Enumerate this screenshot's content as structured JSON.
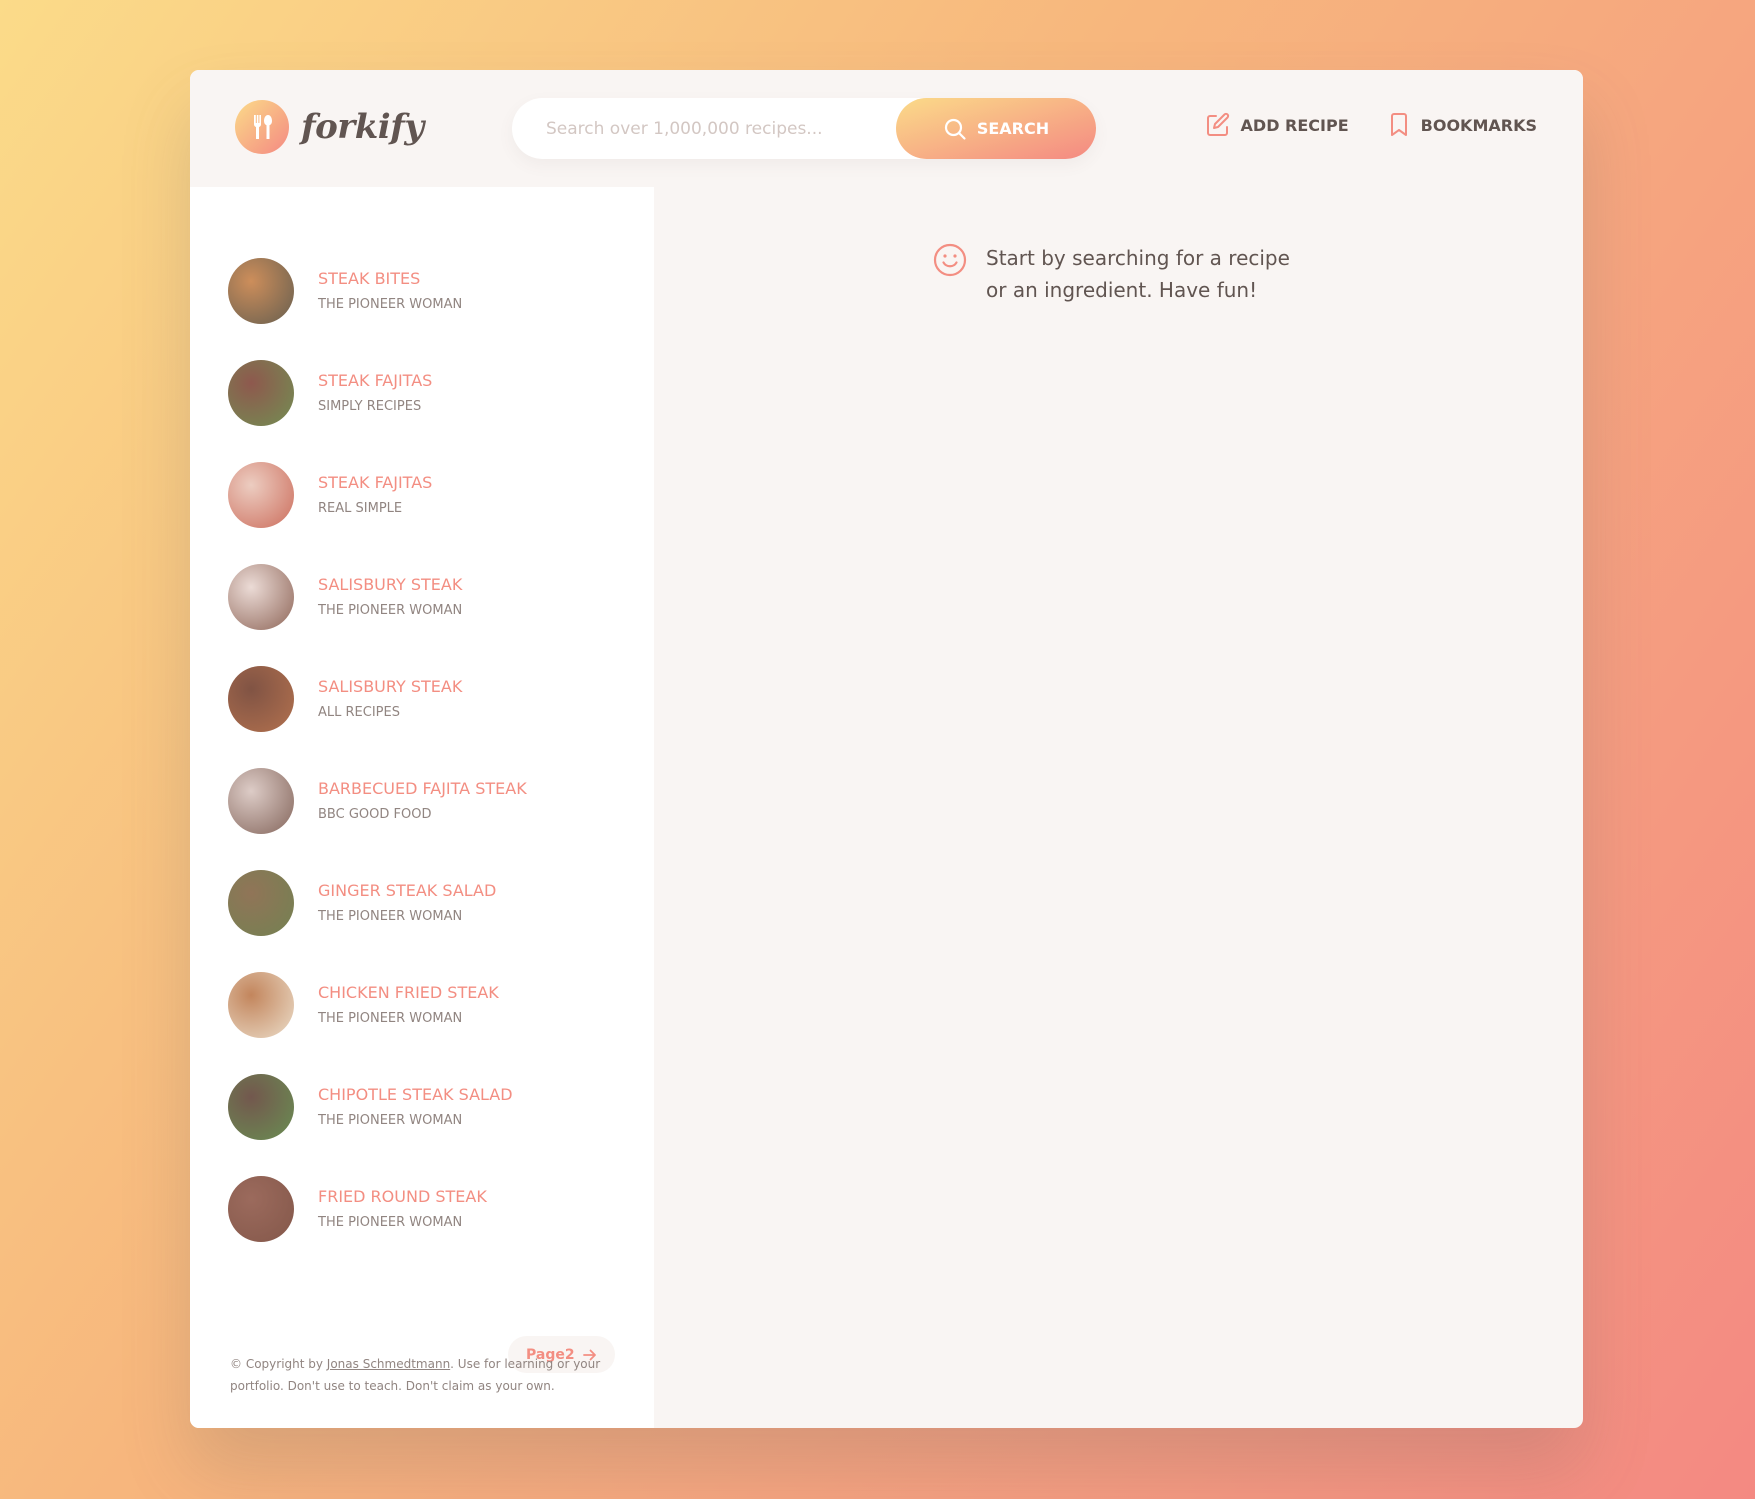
{
  "colors": {
    "accent": "#f38e82",
    "grad_start": "#fbdb89",
    "grad_end": "#f48982",
    "text": "#615551",
    "muted": "#918581"
  },
  "header": {
    "logo_text": "forkify",
    "search": {
      "placeholder": "Search over 1,000,000 recipes...",
      "value": "",
      "button_label": "SEARCH"
    },
    "nav": {
      "add_recipe_label": "ADD RECIPE",
      "bookmarks_label": "BOOKMARKS"
    }
  },
  "results": [
    {
      "title": "STEAK BITES",
      "publisher": "THE PIONEER WOMAN",
      "thumb": [
        "#c47a3e",
        "#4b4230"
      ]
    },
    {
      "title": "STEAK FAJITAS",
      "publisher": "SIMPLY RECIPES",
      "thumb": [
        "#7a3b2e",
        "#5a7a34"
      ]
    },
    {
      "title": "STEAK FAJITAS",
      "publisher": "REAL SIMPLE",
      "thumb": [
        "#e9c4b6",
        "#c3533f"
      ]
    },
    {
      "title": "SALISBURY STEAK",
      "publisher": "THE PIONEER WOMAN",
      "thumb": [
        "#e8d5cf",
        "#7a4a3a"
      ]
    },
    {
      "title": "SALISBURY STEAK",
      "publisher": "ALL RECIPES",
      "thumb": [
        "#6a3523",
        "#a5582f"
      ]
    },
    {
      "title": "BARBECUED FAJITA STEAK",
      "publisher": "BBC GOOD FOOD",
      "thumb": [
        "#d7c3bd",
        "#6e4a3e"
      ]
    },
    {
      "title": "GINGER STEAK SALAD",
      "publisher": "THE PIONEER WOMAN",
      "thumb": [
        "#7d5c3a",
        "#5b6b33"
      ]
    },
    {
      "title": "CHICKEN FRIED STEAK",
      "publisher": "THE PIONEER WOMAN",
      "thumb": [
        "#b87040",
        "#e8d7c0"
      ]
    },
    {
      "title": "CHIPOTLE STEAK SALAD",
      "publisher": "THE PIONEER WOMAN",
      "thumb": [
        "#5a3a2e",
        "#4f7a34"
      ]
    },
    {
      "title": "FRIED ROUND STEAK",
      "publisher": "THE PIONEER WOMAN",
      "thumb": [
        "#8a5040",
        "#6e3a2a"
      ]
    }
  ],
  "pagination": {
    "next_label": "Page2"
  },
  "copyright": {
    "prefix": "© Copyright by ",
    "author": "Jonas Schmedtmann",
    "suffix": ". Use for learning or your portfolio. Don't use to teach. Don't claim as your own."
  },
  "main": {
    "message": "Start by searching for a recipe or an ingredient. Have fun!"
  }
}
